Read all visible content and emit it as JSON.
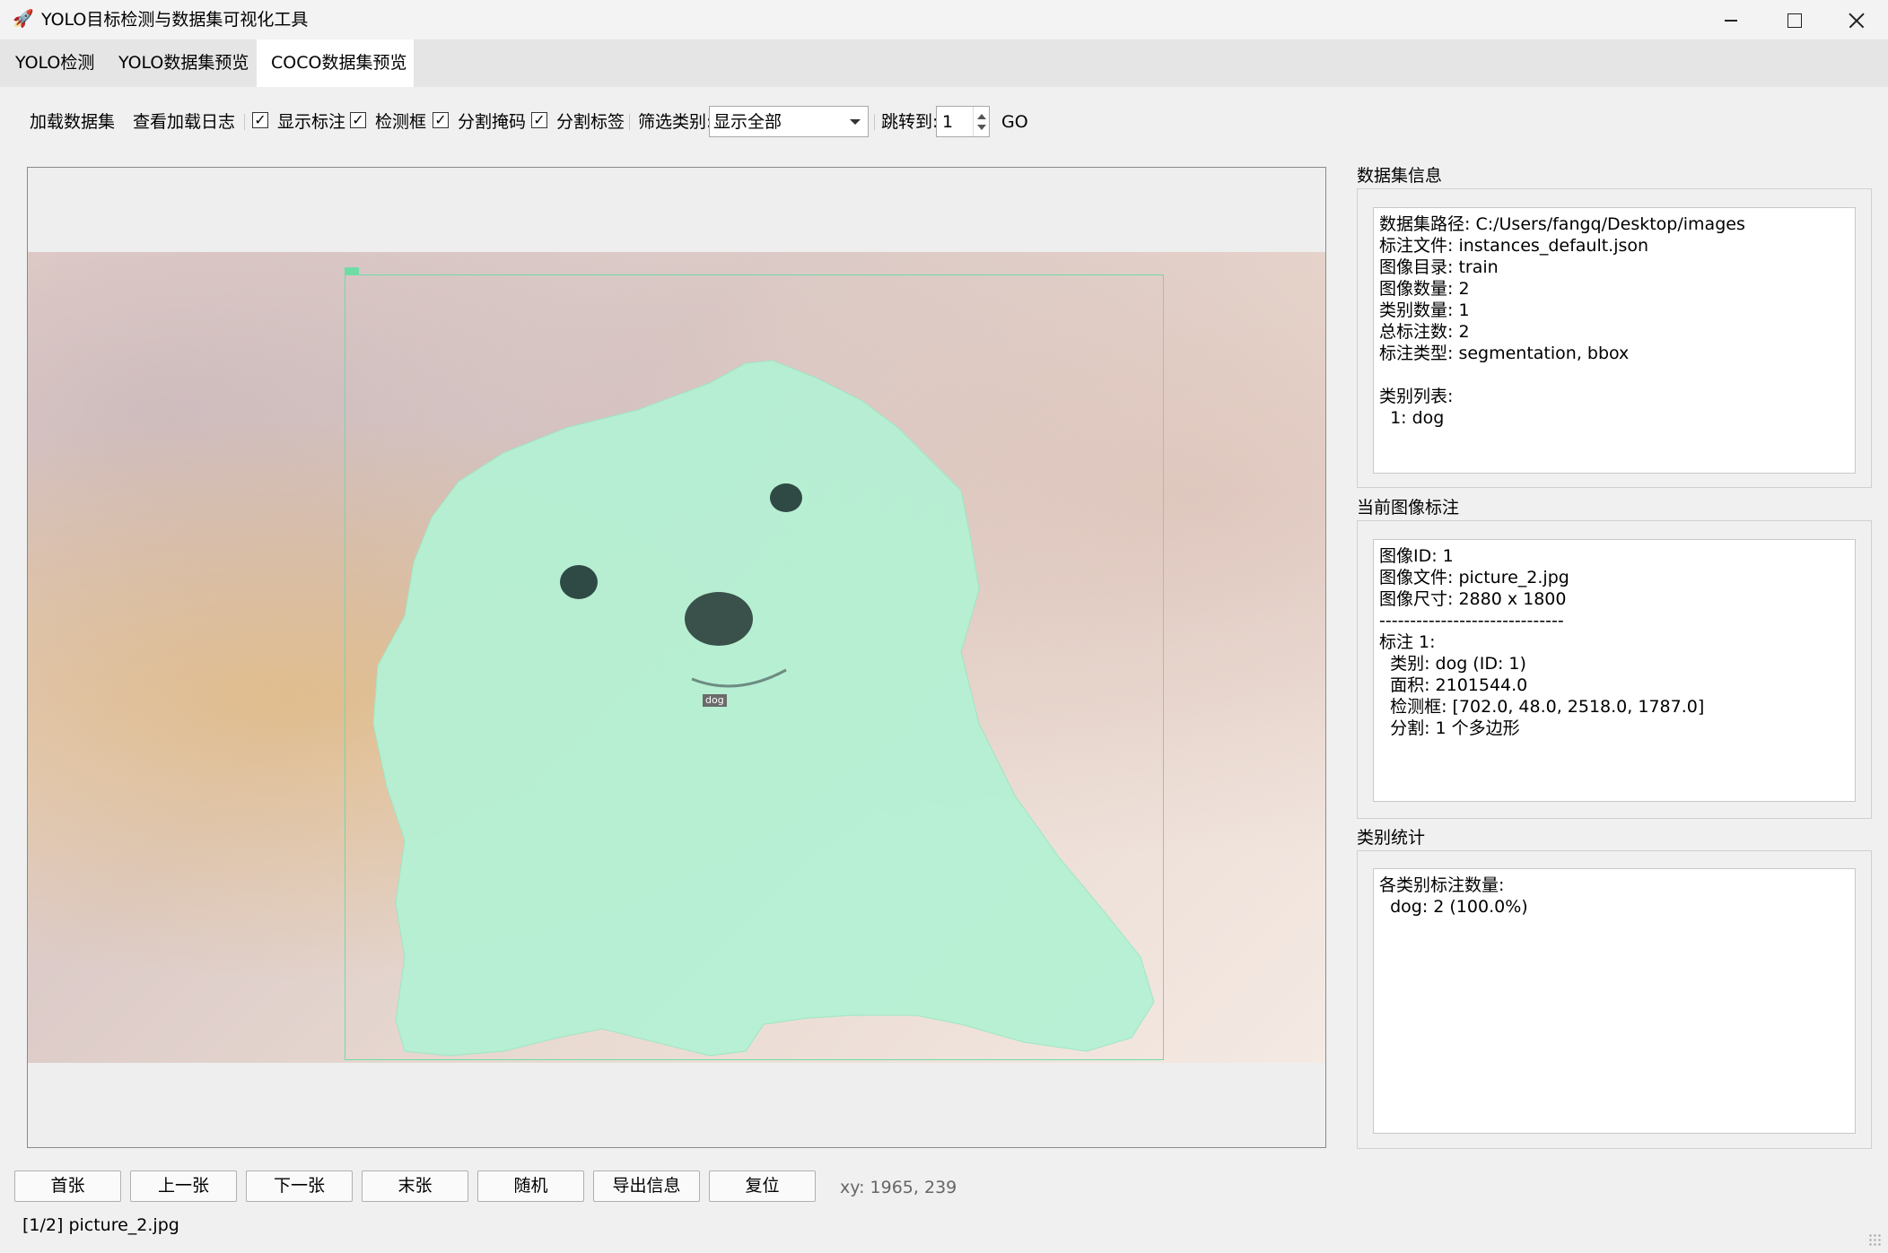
{
  "window": {
    "title": "YOLO目标检测与数据集可视化工具"
  },
  "tabs": [
    {
      "label": "YOLO检测",
      "active": false
    },
    {
      "label": "YOLO数据集预览",
      "active": false
    },
    {
      "label": "COCO数据集预览",
      "active": true
    }
  ],
  "toolbar": {
    "load_dataset": "加载数据集",
    "view_log": "查看加载日志",
    "show_labels": {
      "label": "显示标注",
      "checked": true
    },
    "bbox": {
      "label": "检测框",
      "checked": true
    },
    "seg_mask": {
      "label": "分割掩码",
      "checked": true
    },
    "seg_label": {
      "label": "分割标签",
      "checked": true
    },
    "filter_label": "筛选类别:",
    "filter_value": "显示全部",
    "goto_label": "跳转到:",
    "goto_value": "1",
    "go_button": "GO"
  },
  "viewer": {
    "segmentation_label": "dog",
    "mask_color": "#b4f0d4",
    "box_color": "#6fdca6"
  },
  "sidebar": {
    "dataset_info": {
      "title": "数据集信息",
      "lines": [
        "数据集路径: C:/Users/fangq/Desktop/images",
        "标注文件: instances_default.json",
        "图像目录: train",
        "图像数量: 2",
        "类别数量: 1",
        "总标注数: 2",
        "标注类型: segmentation, bbox",
        "",
        "类别列表:",
        "  1: dog"
      ]
    },
    "current_annotations": {
      "title": "当前图像标注",
      "lines": [
        "图像ID: 1",
        "图像文件: picture_2.jpg",
        "图像尺寸: 2880 x 1800",
        "------------------------------",
        "标注 1:",
        "  类别: dog (ID: 1)",
        "  面积: 2101544.0",
        "  检测框: [702.0, 48.0, 2518.0, 1787.0]",
        "  分割: 1 个多边形"
      ]
    },
    "class_stats": {
      "title": "类别统计",
      "lines": [
        "各类别标注数量:",
        "  dog: 2 (100.0%)"
      ]
    }
  },
  "nav_buttons": {
    "first": "首张",
    "prev": "上一张",
    "next": "下一张",
    "last": "末张",
    "random": "随机",
    "export": "导出信息",
    "reset": "复位"
  },
  "coords_readout": "xy: 1965, 239",
  "status": "[1/2] picture_2.jpg"
}
